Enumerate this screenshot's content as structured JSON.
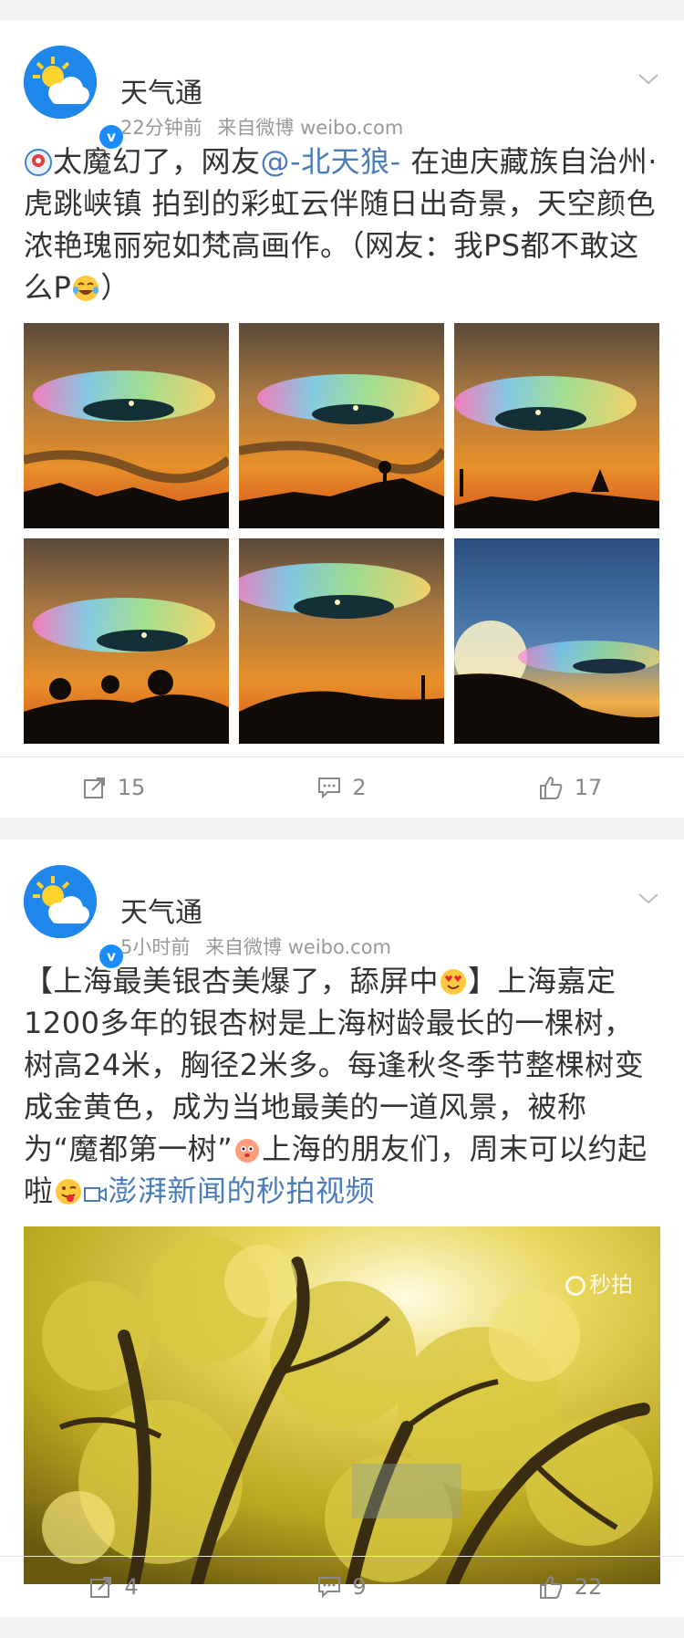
{
  "posts": [
    {
      "author": "天气通",
      "time": "22分钟前",
      "source": "来自微博 weibo.com",
      "text_prefix": "太魔幻了，网友",
      "mention": "@-北天狼-",
      "text_suffix": " 在迪庆藏族自治州·虎跳峡镇 拍到的彩虹云伴随日出奇景，天空颜色浓艳瑰丽宛如梵高画作。（网友：我PS都不敢这么P",
      "text_end": "）",
      "leading_icon": "weather-bubble-icon",
      "trailing_emoji": "laugh-cry-emoji",
      "image_count": 6,
      "repost_count": "15",
      "comment_count": "2",
      "like_count": "17"
    },
    {
      "author": "天气通",
      "time": "5小时前",
      "source": "来自微博 weibo.com",
      "text_a": "【上海最美银杏美爆了，舔屏中",
      "text_b": "】上海嘉定1200多年的银杏树是上海树龄最长的一棵树，树高24米，胸径2米多。每逢秋冬季节整棵树变成金黄色，成为当地最美的一道风景，被称为“魔都第一树”",
      "text_c": "上海的朋友们，周末可以约起啦",
      "video_link": "澎湃新闻的秒拍视频",
      "watermark": "秒拍",
      "repost_count": "4",
      "comment_count": "9",
      "like_count": "22"
    }
  ],
  "colors": {
    "link": "#4a7db8",
    "verified": "#1a8cff",
    "meta": "#999999",
    "background": "#f2f2f2"
  },
  "icons": [
    "sun-cloud-avatar-icon",
    "verified-badge-icon",
    "chevron-down-icon",
    "repost-icon",
    "comment-icon",
    "like-icon"
  ]
}
